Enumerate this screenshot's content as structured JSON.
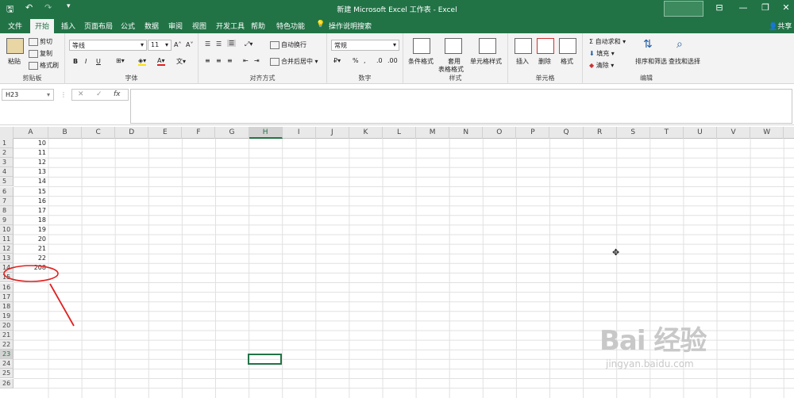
{
  "window": {
    "title": "新建 Microsoft Excel 工作表 - Excel",
    "share_label": "共享"
  },
  "tabs": [
    {
      "label": "文件"
    },
    {
      "label": "开始"
    },
    {
      "label": "插入"
    },
    {
      "label": "页面布局"
    },
    {
      "label": "公式"
    },
    {
      "label": "数据"
    },
    {
      "label": "审阅"
    },
    {
      "label": "视图"
    },
    {
      "label": "开发工具"
    },
    {
      "label": "帮助"
    },
    {
      "label": "特色功能"
    },
    {
      "label": "操作说明搜索"
    }
  ],
  "ribbon": {
    "clipboard": {
      "group": "剪贴板",
      "paste": "粘贴",
      "cut": "剪切",
      "copy": "复制",
      "format_painter": "格式刷"
    },
    "font": {
      "group": "字体",
      "font_name": "等线",
      "font_size": "11",
      "bold": "B",
      "italic": "I",
      "underline": "U"
    },
    "alignment": {
      "group": "对齐方式",
      "wrap": "自动换行",
      "merge": "合并后居中"
    },
    "number": {
      "group": "数字",
      "format": "常规",
      "percent": "%",
      "comma": ","
    },
    "styles": {
      "group": "样式",
      "conditional": "条件格式",
      "table_top": "套用",
      "table_bottom": "表格格式",
      "cell_styles": "单元格样式"
    },
    "cells": {
      "group": "单元格",
      "insert": "插入",
      "delete": "删除",
      "format": "格式"
    },
    "editing": {
      "group": "编辑",
      "autosum": "自动求和",
      "fill": "填充",
      "clear": "清除",
      "sort": "排序和筛选",
      "find": "查找和选择"
    }
  },
  "formula_bar": {
    "name_box": "H23",
    "fx": "fx",
    "value": ""
  },
  "sheet": {
    "columns": [
      "A",
      "B",
      "C",
      "D",
      "E",
      "F",
      "G",
      "H",
      "I",
      "J",
      "K",
      "L",
      "M",
      "N",
      "O",
      "P",
      "Q",
      "R",
      "S",
      "T",
      "U",
      "V",
      "W"
    ],
    "selected_column": "H",
    "selected_row": 23,
    "rows": [
      1,
      2,
      3,
      4,
      5,
      6,
      7,
      8,
      9,
      10,
      11,
      12,
      13,
      14,
      15,
      16,
      17,
      18,
      19,
      20,
      21,
      22,
      23,
      24,
      25,
      26
    ],
    "col_a_values": [
      "10",
      "11",
      "12",
      "13",
      "14",
      "15",
      "16",
      "17",
      "18",
      "19",
      "20",
      "21",
      "22",
      "208"
    ]
  },
  "watermark": {
    "line1": "Bai 经验",
    "line2": "jingyan.baidu.com"
  },
  "colors": {
    "brand": "#217346",
    "annotation": "#e02020"
  }
}
